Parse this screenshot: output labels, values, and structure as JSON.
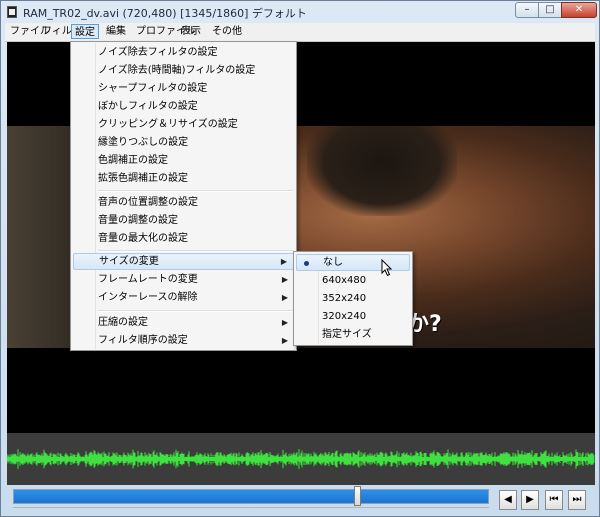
{
  "window": {
    "title": "RAM_TR02_dv.avi (720,480)  [1345/1860]  デフォルト",
    "min_label": "–",
    "max_label": "□",
    "close_label": "✕"
  },
  "menubar": {
    "items": [
      {
        "label": "ファイル"
      },
      {
        "label": "フィルタ"
      },
      {
        "label": "設定"
      },
      {
        "label": "編集"
      },
      {
        "label": "プロファイル"
      },
      {
        "label": "表示"
      },
      {
        "label": "その他"
      }
    ]
  },
  "settings_menu": {
    "items": [
      {
        "label": "ノイズ除去フィルタの設定"
      },
      {
        "label": "ノイズ除去(時間軸)フィルタの設定"
      },
      {
        "label": "シャープフィルタの設定"
      },
      {
        "label": "ぼかしフィルタの設定"
      },
      {
        "label": "クリッピング＆リサイズの設定"
      },
      {
        "label": "縁塗りつぶしの設定"
      },
      {
        "label": "色調補正の設定"
      },
      {
        "label": "拡張色調補正の設定"
      },
      {
        "label": "音声の位置調整の設定"
      },
      {
        "label": "音量の調整の設定"
      },
      {
        "label": "音量の最大化の設定"
      },
      {
        "label": "サイズの変更"
      },
      {
        "label": "フレームレートの変更"
      },
      {
        "label": "インターレースの解除"
      },
      {
        "label": "圧縮の設定"
      },
      {
        "label": "フィルタ順序の設定"
      }
    ],
    "arrow": "▶"
  },
  "size_submenu": {
    "items": [
      {
        "label": "なし",
        "checked": true
      },
      {
        "label": "640x480"
      },
      {
        "label": "352x240"
      },
      {
        "label": "320x240"
      },
      {
        "label": "指定サイズ"
      }
    ]
  },
  "video": {
    "subtitle": "か?"
  },
  "seek": {
    "position_fraction": 0.723
  },
  "nav": {
    "prev_frame": "◀",
    "next_frame": "▶",
    "first": "⏮",
    "last": "⏭"
  },
  "colors": {
    "waveform": "#3fe03f",
    "seek_fill": "#1a76d2",
    "menu_highlight": "#d6e7f7"
  }
}
